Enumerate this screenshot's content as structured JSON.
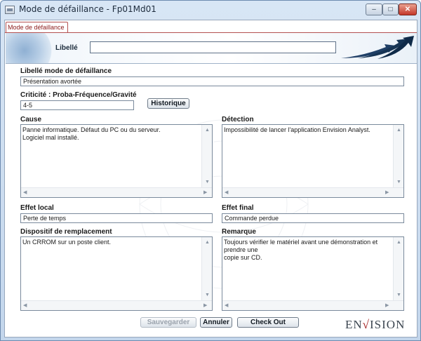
{
  "window": {
    "title": "Mode de défaillance - Fp01Md01",
    "controls": {
      "minimize": "–",
      "maximize": "□",
      "close": "✕"
    }
  },
  "tabs": [
    {
      "label": "Mode de défaillance"
    }
  ],
  "banner": {
    "label": "Libellé",
    "value": ""
  },
  "form": {
    "libelle_mode": {
      "label": "Libellé mode de défaillance",
      "value": "Présentation avortée"
    },
    "criticite": {
      "label": "Criticité : Proba-Fréquence/Gravité",
      "value": "4-5"
    },
    "cause": {
      "label": "Cause",
      "value": "Panne informatique. Défaut du PC ou du serveur.\nLogiciel mal installé."
    },
    "detection": {
      "label": "Détection",
      "value": "Impossibilité de lancer l'application Envision Analyst."
    },
    "effet_local": {
      "label": "Effet local",
      "value": "Perte de temps"
    },
    "effet_final": {
      "label": "Effet final",
      "value": "Commande perdue"
    },
    "dispositif": {
      "label": "Dispositif de remplacement",
      "value": "Un CRROM sur un poste client."
    },
    "remarque": {
      "label": "Remarque",
      "value": "Toujours vérifier le matériel avant une démonstration et prendre une\ncopie sur CD."
    }
  },
  "buttons": {
    "historique": "Historique",
    "sauvegarder": "Sauvegarder",
    "annuler": "Annuler",
    "checkout": "Check Out"
  },
  "brand": {
    "part1": "EN",
    "part2": "√",
    "part3": "ISION"
  },
  "colors": {
    "tab_accent": "#b35050",
    "brand_red": "#a01c1c",
    "frame_blue": "#c3d6ec"
  },
  "icons": {
    "scroll_up": "▲",
    "scroll_down": "▼",
    "scroll_left": "◀",
    "scroll_right": "▶"
  }
}
